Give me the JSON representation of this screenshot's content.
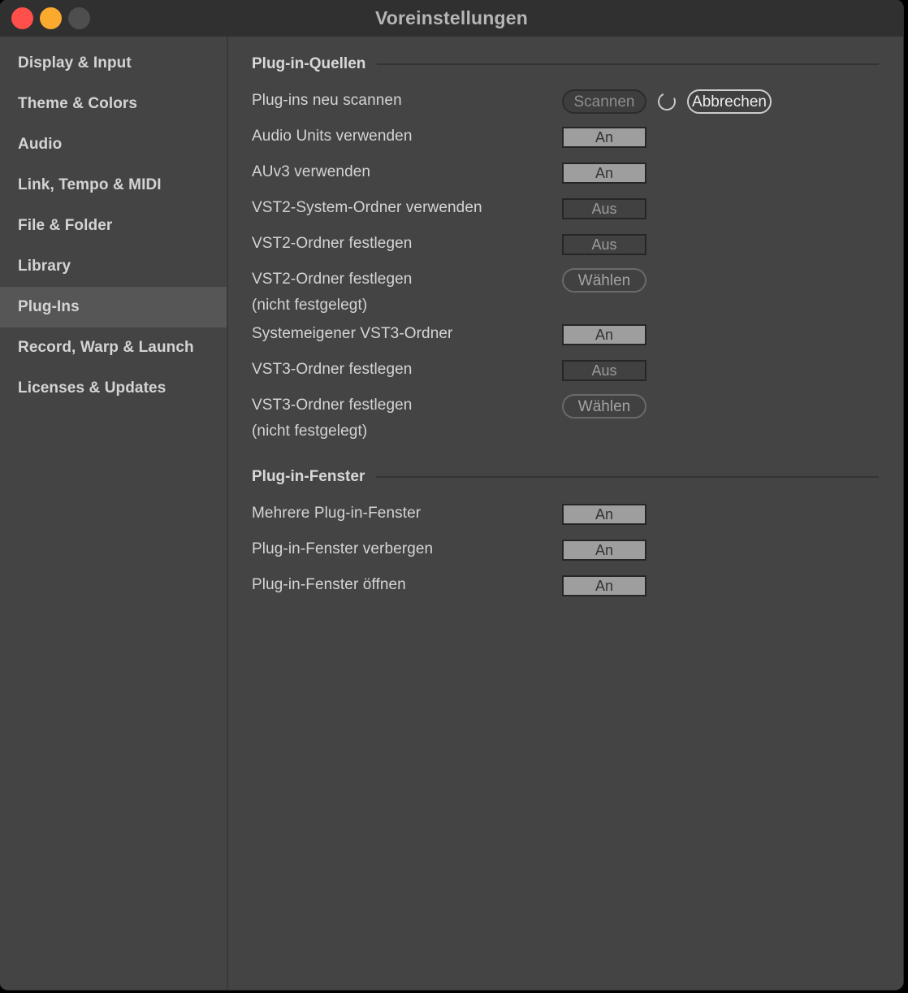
{
  "window": {
    "title": "Voreinstellungen",
    "traffic_lights": [
      {
        "name": "close",
        "color": "#ff4f4a"
      },
      {
        "name": "minimize",
        "color": "#fbaa2d"
      },
      {
        "name": "zoom",
        "color": "#4e4e4e"
      }
    ]
  },
  "sidebar": {
    "items": [
      {
        "label": "Display & Input",
        "selected": false
      },
      {
        "label": "Theme & Colors",
        "selected": false
      },
      {
        "label": "Audio",
        "selected": false
      },
      {
        "label": "Link, Tempo & MIDI",
        "selected": false
      },
      {
        "label": "File & Folder",
        "selected": false
      },
      {
        "label": "Library",
        "selected": false
      },
      {
        "label": "Plug-Ins",
        "selected": true
      },
      {
        "label": "Record, Warp & Launch",
        "selected": false
      },
      {
        "label": "Licenses & Updates",
        "selected": false
      }
    ]
  },
  "sections": [
    {
      "title": "Plug-in-Quellen",
      "rows": [
        {
          "label": "Plug-ins neu scannen",
          "control": "scan-group",
          "scan_label": "Scannen",
          "cancel_label": "Abbrechen",
          "spinner": "loading-spinner-icon"
        },
        {
          "label": "Audio Units verwenden",
          "control": "toggle",
          "value": "An"
        },
        {
          "label": "AUv3 verwenden",
          "control": "toggle",
          "value": "An"
        },
        {
          "label": "VST2-System-Ordner verwenden",
          "control": "toggle",
          "value": "Aus"
        },
        {
          "label": "VST2-Ordner festlegen",
          "control": "toggle",
          "value": "Aus"
        },
        {
          "label": "VST2-Ordner festlegen\n(nicht festgelegt)",
          "control": "pill",
          "value": "Wählen"
        },
        {
          "label": "Systemeigener VST3-Ordner",
          "control": "toggle",
          "value": "An"
        },
        {
          "label": "VST3-Ordner festlegen",
          "control": "toggle",
          "value": "Aus"
        },
        {
          "label": "VST3-Ordner festlegen\n(nicht festgelegt)",
          "control": "pill",
          "value": "Wählen"
        }
      ]
    },
    {
      "title": "Plug-in-Fenster",
      "rows": [
        {
          "label": "Mehrere Plug-in-Fenster",
          "control": "toggle",
          "value": "An"
        },
        {
          "label": "Plug-in-Fenster verbergen",
          "control": "toggle",
          "value": "An"
        },
        {
          "label": "Plug-in-Fenster öffnen",
          "control": "toggle",
          "value": "An"
        }
      ]
    }
  ],
  "colors": {
    "window_bg": "#444444",
    "titlebar_bg": "#303030",
    "selected_row": "#565656",
    "toggle_on_bg": "#9e9e9e",
    "toggle_off_bg": "#414141",
    "text": "#d4d4d4",
    "rule": "#343434"
  }
}
